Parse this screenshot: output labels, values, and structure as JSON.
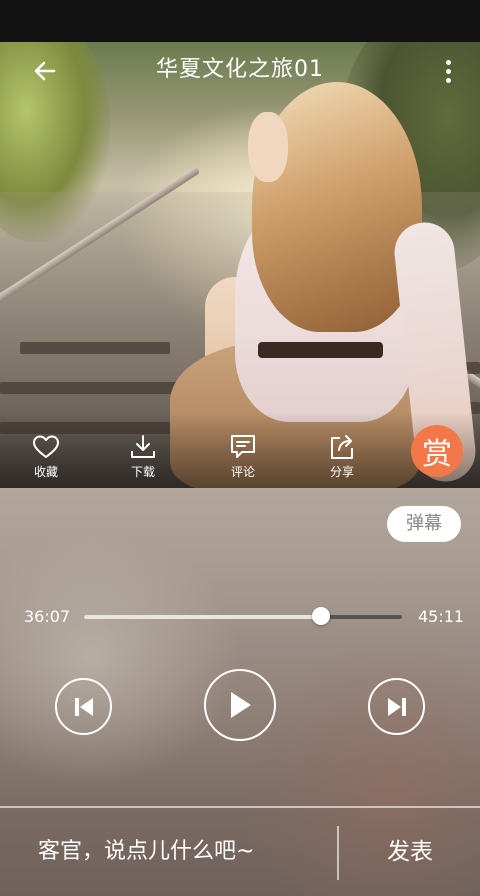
{
  "header": {
    "title": "华夏文化之旅01",
    "back_icon": "arrow-left-icon",
    "more_icon": "more-vertical-icon"
  },
  "actions": [
    {
      "label": "收藏",
      "icon": "heart-icon"
    },
    {
      "label": "下载",
      "icon": "download-icon"
    },
    {
      "label": "评论",
      "icon": "comment-icon"
    },
    {
      "label": "分享",
      "icon": "share-icon"
    }
  ],
  "reward": {
    "label": "赏",
    "color": "#f2784a"
  },
  "danmu": {
    "label": "弹幕"
  },
  "player": {
    "current_time": "36:07",
    "total_time": "45:11",
    "progress": 0.745,
    "prev_icon": "skip-previous-icon",
    "play_icon": "play-icon",
    "next_icon": "skip-next-icon"
  },
  "comment": {
    "placeholder": "客官，说点儿什么吧~",
    "send_label": "发表"
  }
}
